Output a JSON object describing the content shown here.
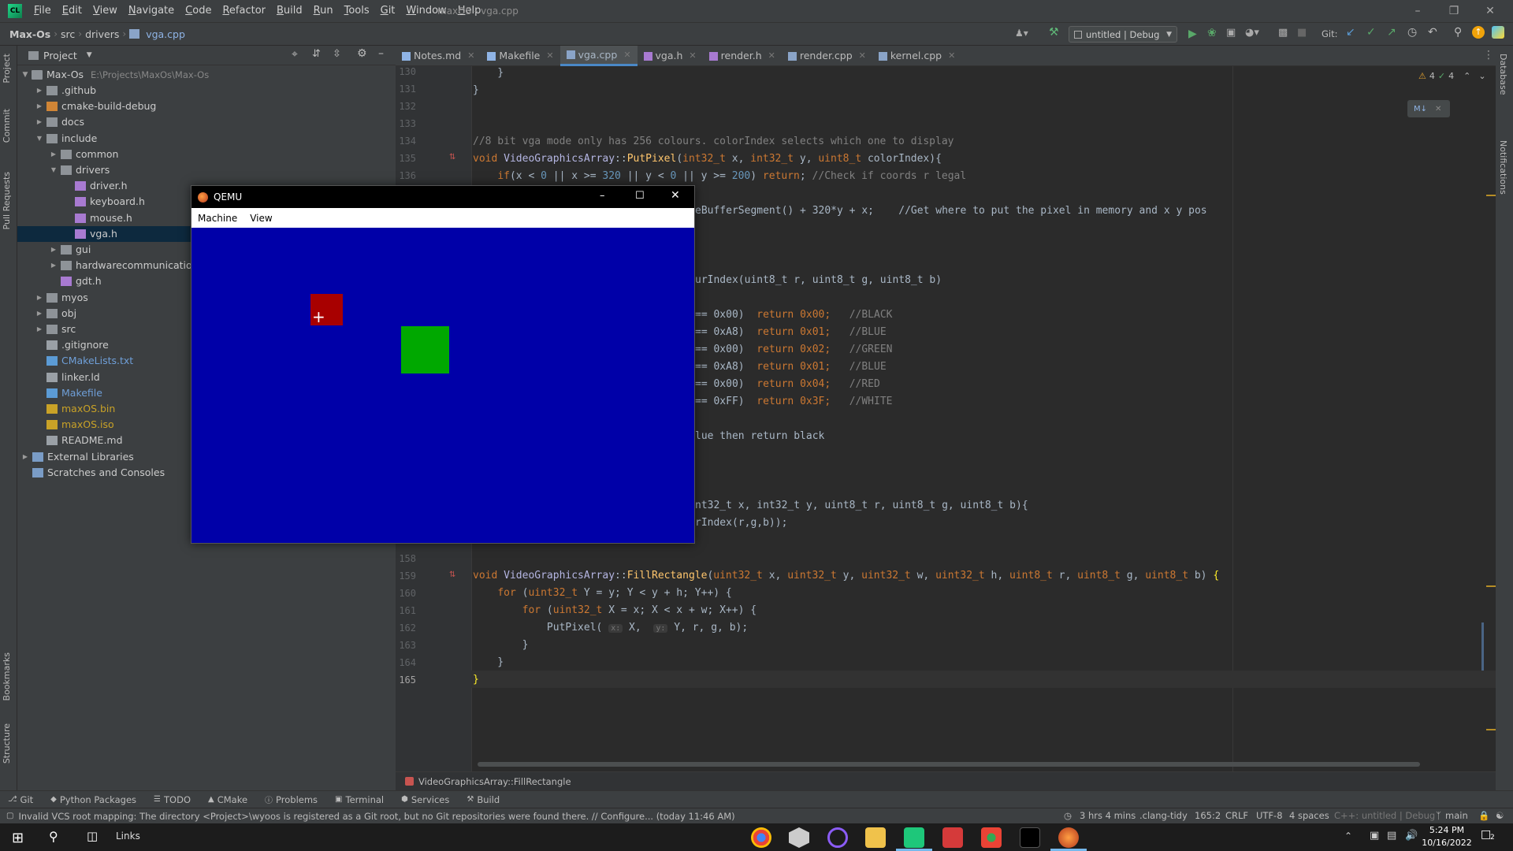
{
  "app": {
    "window_title": "maxOS - vga.cpp",
    "menu": [
      "File",
      "Edit",
      "View",
      "Navigate",
      "Code",
      "Refactor",
      "Build",
      "Run",
      "Tools",
      "Git",
      "Window",
      "Help"
    ]
  },
  "nav": {
    "breadcrumbs": [
      "Max-Os",
      "src",
      "drivers",
      "vga.cpp"
    ],
    "run_config": "untitled | Debug",
    "git_label": "Git:"
  },
  "project": {
    "header": "Project",
    "root_name": "Max-Os",
    "root_path": "E:\\Projects\\MaxOs\\Max-Os",
    "items": [
      {
        "label": ".github",
        "type": "folder",
        "depth": 1,
        "arrow": "›"
      },
      {
        "label": "cmake-build-debug",
        "type": "folder-orange",
        "depth": 1,
        "arrow": "›"
      },
      {
        "label": "docs",
        "type": "folder",
        "depth": 1,
        "arrow": "›"
      },
      {
        "label": "include",
        "type": "folder",
        "depth": 1,
        "arrow": "⌄"
      },
      {
        "label": "common",
        "type": "folder",
        "depth": 2,
        "arrow": "›"
      },
      {
        "label": "drivers",
        "type": "folder",
        "depth": 2,
        "arrow": "⌄"
      },
      {
        "label": "driver.h",
        "type": "hfile",
        "depth": 3,
        "arrow": ""
      },
      {
        "label": "keyboard.h",
        "type": "hfile",
        "depth": 3,
        "arrow": ""
      },
      {
        "label": "mouse.h",
        "type": "hfile",
        "depth": 3,
        "arrow": ""
      },
      {
        "label": "vga.h",
        "type": "hfile",
        "depth": 3,
        "arrow": "",
        "selected": true
      },
      {
        "label": "gui",
        "type": "folder",
        "depth": 2,
        "arrow": "›"
      },
      {
        "label": "hardwarecommunication",
        "type": "folder",
        "depth": 2,
        "arrow": "›"
      },
      {
        "label": "gdt.h",
        "type": "hfile",
        "depth": 2,
        "arrow": ""
      },
      {
        "label": "myos",
        "type": "folder",
        "depth": 1,
        "arrow": "›"
      },
      {
        "label": "obj",
        "type": "folder",
        "depth": 1,
        "arrow": "›"
      },
      {
        "label": "src",
        "type": "folder",
        "depth": 1,
        "arrow": "›"
      },
      {
        "label": ".gitignore",
        "type": "file",
        "depth": 1,
        "arrow": ""
      },
      {
        "label": "CMakeLists.txt",
        "type": "file-blue",
        "depth": 1,
        "arrow": ""
      },
      {
        "label": "linker.ld",
        "type": "file",
        "depth": 1,
        "arrow": ""
      },
      {
        "label": "Makefile",
        "type": "file-blue",
        "depth": 1,
        "arrow": ""
      },
      {
        "label": "maxOS.bin",
        "type": "file-yellow",
        "depth": 1,
        "arrow": ""
      },
      {
        "label": "maxOS.iso",
        "type": "file-yellow",
        "depth": 1,
        "arrow": ""
      },
      {
        "label": "README.md",
        "type": "file",
        "depth": 1,
        "arrow": ""
      },
      {
        "label": "External Libraries",
        "type": "lib",
        "depth": 0,
        "arrow": "›"
      },
      {
        "label": "Scratches and Consoles",
        "type": "lib",
        "depth": 0,
        "arrow": ""
      }
    ]
  },
  "left_strip": {
    "project": "Project",
    "commit": "Commit",
    "pull": "Pull Requests",
    "bookmarks": "Bookmarks",
    "structure": "Structure"
  },
  "right_strip": {
    "database": "Database",
    "notifications": "Notifications"
  },
  "tabs": [
    {
      "label": "Notes.md",
      "active": false
    },
    {
      "label": "Makefile",
      "active": false
    },
    {
      "label": "vga.cpp",
      "active": true
    },
    {
      "label": "vga.h",
      "active": false
    },
    {
      "label": "render.h",
      "active": false
    },
    {
      "label": "render.cpp",
      "active": false
    },
    {
      "label": "kernel.cpp",
      "active": false
    }
  ],
  "inspections": {
    "warnings": "4",
    "ok": "4"
  },
  "code": {
    "line_numbers": [
      "130",
      "131",
      "132",
      "133",
      "134",
      "135",
      "136",
      "158",
      "159",
      "160",
      "161",
      "162",
      "163",
      "164",
      "165"
    ],
    "l130": "    }",
    "l131": "}",
    "l134": "//8 bit vga mode only has 256 colours. colorIndex selects which one to display",
    "l137_tail": "eBufferSegment() + 320*y + x;    //Get where to put the pixel in memory and x y pos",
    "l141_tail": "urIndex(uint8_t r, uint8_t g, uint8_t b)",
    "color_rows": [
      {
        "cmp": "== 0x00)",
        "ret": "return 0x00;",
        "cm": "//BLACK"
      },
      {
        "cmp": "== 0xA8)",
        "ret": "return 0x01;",
        "cm": "//BLUE"
      },
      {
        "cmp": "== 0x00)",
        "ret": "return 0x02;",
        "cm": "//GREEN"
      },
      {
        "cmp": "== 0xA8)",
        "ret": "return 0x01;",
        "cm": "//BLUE"
      },
      {
        "cmp": "== 0x00)",
        "ret": "return 0x04;",
        "cm": "//RED"
      },
      {
        "cmp": "== 0xFF)",
        "ret": "return 0x3F;",
        "cm": "//WHITE"
      }
    ],
    "l150_tail": "lue then return black",
    "l154_tail": "nt32_t x, int32_t y, uint8_t r, uint8_t g, uint8_t b){",
    "l155_tail": "rIndex(r,g,b));",
    "breadcrumb_fn": "VideoGraphicsArray::FillRectangle"
  },
  "qemu": {
    "title": "QEMU",
    "menu": [
      "Machine",
      "View"
    ],
    "bg": "#0000a8",
    "red_rect_color": "#a80000",
    "green_rect_color": "#00a800"
  },
  "bottom_tools": [
    "Git",
    "Python Packages",
    "TODO",
    "CMake",
    "Problems",
    "Terminal",
    "Services",
    "Build"
  ],
  "status": {
    "message": "Invalid VCS root mapping: The directory <Project>\\wyoos is registered as a Git root, but no Git repositories were found there. // Configure... (today 11:46 AM)",
    "time_tracker": "3 hrs 4 mins",
    "linter": ".clang-tidy",
    "position": "165:2",
    "line_ending": "CRLF",
    "encoding": "UTF-8",
    "indent": "4 spaces",
    "context": "C++: untitled | Debug",
    "branch": "main"
  },
  "taskbar": {
    "links": "Links",
    "time": "5:24 PM",
    "date": "10/16/2022",
    "notif_count": "2"
  }
}
